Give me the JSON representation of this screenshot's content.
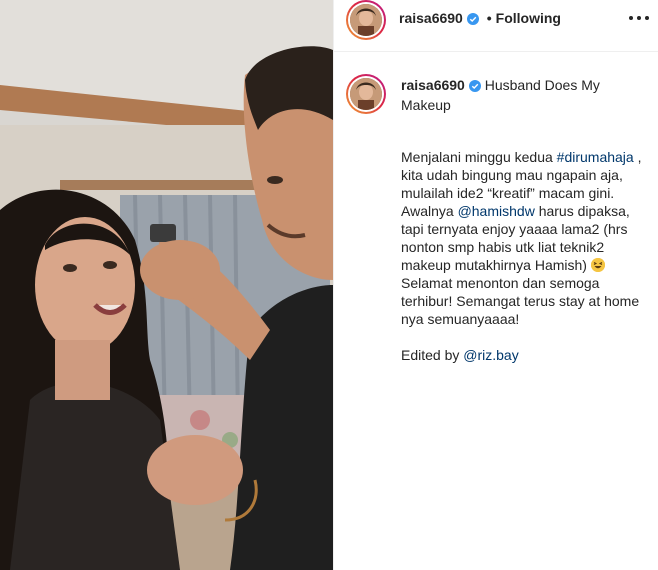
{
  "post": {
    "username": "raisa6690",
    "follow_status": "Following",
    "dot": "•",
    "caption_title": "Husband Does My Makeup",
    "caption_part1": "Menjalani minggu kedua ",
    "hashtag": "#dirumahaja",
    "caption_part2": " , kita udah bingung mau ngapain aja, mulailah ide2 “kreatif” macam gini. Awalnya ",
    "mention1": "@hamishdw",
    "caption_part3": " harus dipaksa, tapi ternyata enjoy yaaaa lama2 (hrs nonton smp habis utk liat teknik2 makeup mutakhirnya Hamish) ",
    "caption_part4": " Selamat menonton dan semoga terhibur! Semangat terus stay at home nya semuanyaaaa!",
    "edited_prefix": "Edited by ",
    "mention2": "@riz.bay",
    "emoji_name": "grinning-squinting-face-icon"
  },
  "colors": {
    "verified": "#3897f0",
    "link": "#00376b",
    "text": "#262626"
  }
}
